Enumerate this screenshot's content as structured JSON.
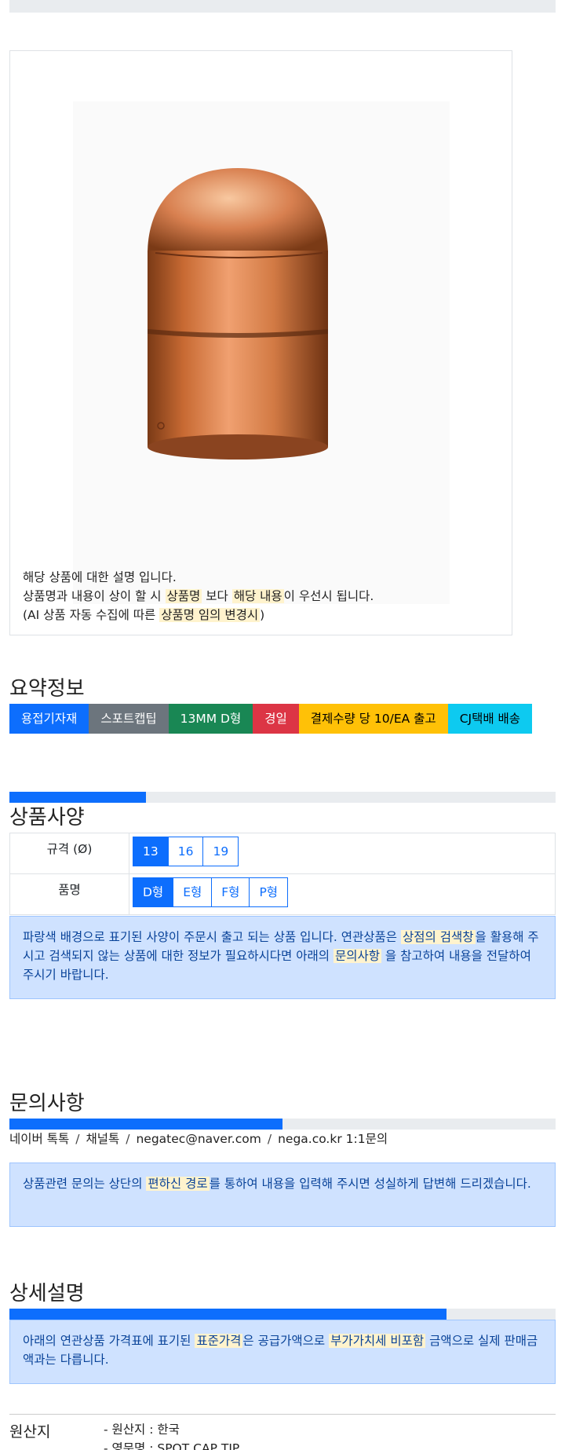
{
  "image_box": {
    "desc_line1": "해당 상품에 대한 설명 입니다.",
    "desc_line2_a": "상품명과 내용이 상이 할 시",
    "desc_line2_hl1": "상품명",
    "desc_line2_b": "보다",
    "desc_line2_hl2": "해당 내용",
    "desc_line2_c": "이 우선시 됩니다.",
    "desc_line3_a": "(AI 상품 자동 수집에 따른",
    "desc_line3_hl": "상품명 임의 변경시",
    "desc_line3_b": ")"
  },
  "summary": {
    "title": "요약정보",
    "badges": [
      {
        "label": "용접기자재",
        "color": "#0d6efd",
        "text": "#ffffff"
      },
      {
        "label": "스포트캡팁",
        "color": "#6c757d",
        "text": "#ffffff"
      },
      {
        "label": "13MM D형",
        "color": "#198754",
        "text": "#ffffff"
      },
      {
        "label": "경일",
        "color": "#dc3545",
        "text": "#ffffff"
      },
      {
        "label": "결제수량 당 10/EA 출고",
        "color": "#ffc107",
        "text": "#000000"
      },
      {
        "label": "CJ택배 배송",
        "color": "#0dcaf0",
        "text": "#000000"
      }
    ]
  },
  "specs": {
    "progress": 0.25,
    "title": "상품사양",
    "rows": [
      {
        "label": "규격 (Ø)",
        "options": [
          "13",
          "16",
          "19"
        ],
        "selected": 0
      },
      {
        "label": "품명",
        "options": [
          "D형",
          "E형",
          "F형",
          "P형"
        ],
        "selected": 0
      }
    ],
    "notice_a": "파랑색 배경으로 표기된 사양이 주문시 출고 되는 상품 입니다. 연관상품은",
    "notice_hl1": "상점의 검색창",
    "notice_b": "을 활용해 주시고 검색되지 않는 상품에 대한 정보가 필요하시다면 아래의",
    "notice_hl2": "문의사항",
    "notice_c": "을 참고하여 내용을 전달하여 주시기 바랍니다."
  },
  "inquiry": {
    "title": "문의사항",
    "progress": 0.5,
    "contacts": [
      "네이버 톡톡",
      "채널톡",
      "negatec@naver.com",
      "nega.co.kr 1:1문의"
    ],
    "separator": "/",
    "notice_a": "상품관련 문의는 상단의",
    "notice_hl": "편하신 경로",
    "notice_b": "를 통하여 내용을 입력해 주시면 성실하게 답변해 드리겠습니다."
  },
  "detail": {
    "title": "상세설명",
    "progress": 0.8,
    "notice_a": "아래의 연관상품 가격표에 표기된",
    "notice_hl1": "표준가격",
    "notice_b": "은 공급가액으로",
    "notice_hl2": "부가가치세 비포함",
    "notice_c": "금액으로 실제 판매금액과는 다릅니다."
  },
  "origin": {
    "title": "원산지",
    "items": [
      "- 원산지 : 한국",
      "- 영문명 : SPOT CAP TIP"
    ]
  }
}
